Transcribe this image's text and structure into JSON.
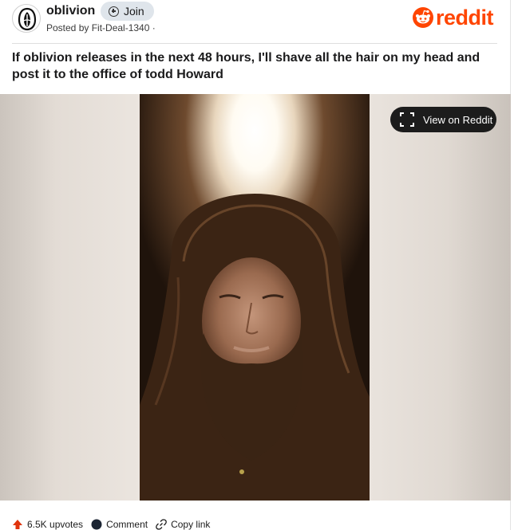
{
  "header": {
    "subreddit_name": "oblivion",
    "join_label": "Join",
    "posted_by": "Posted by Fit-Deal-1340 ·",
    "brand_word": "reddit"
  },
  "post": {
    "title": "If oblivion releases in the next 48 hours, I'll shave all the hair on my head and post it to the office of todd Howard"
  },
  "media": {
    "view_button_label": "View on Reddit",
    "image_description_icon": "photo"
  },
  "footer": {
    "upvotes_label": "6.5K upvotes",
    "comment_label": "Comment",
    "copy_link_label": "Copy link"
  },
  "colors": {
    "brand": "#ff4500",
    "join_bg": "#dfe5eb",
    "view_button_bg": "#1c1c1c"
  }
}
